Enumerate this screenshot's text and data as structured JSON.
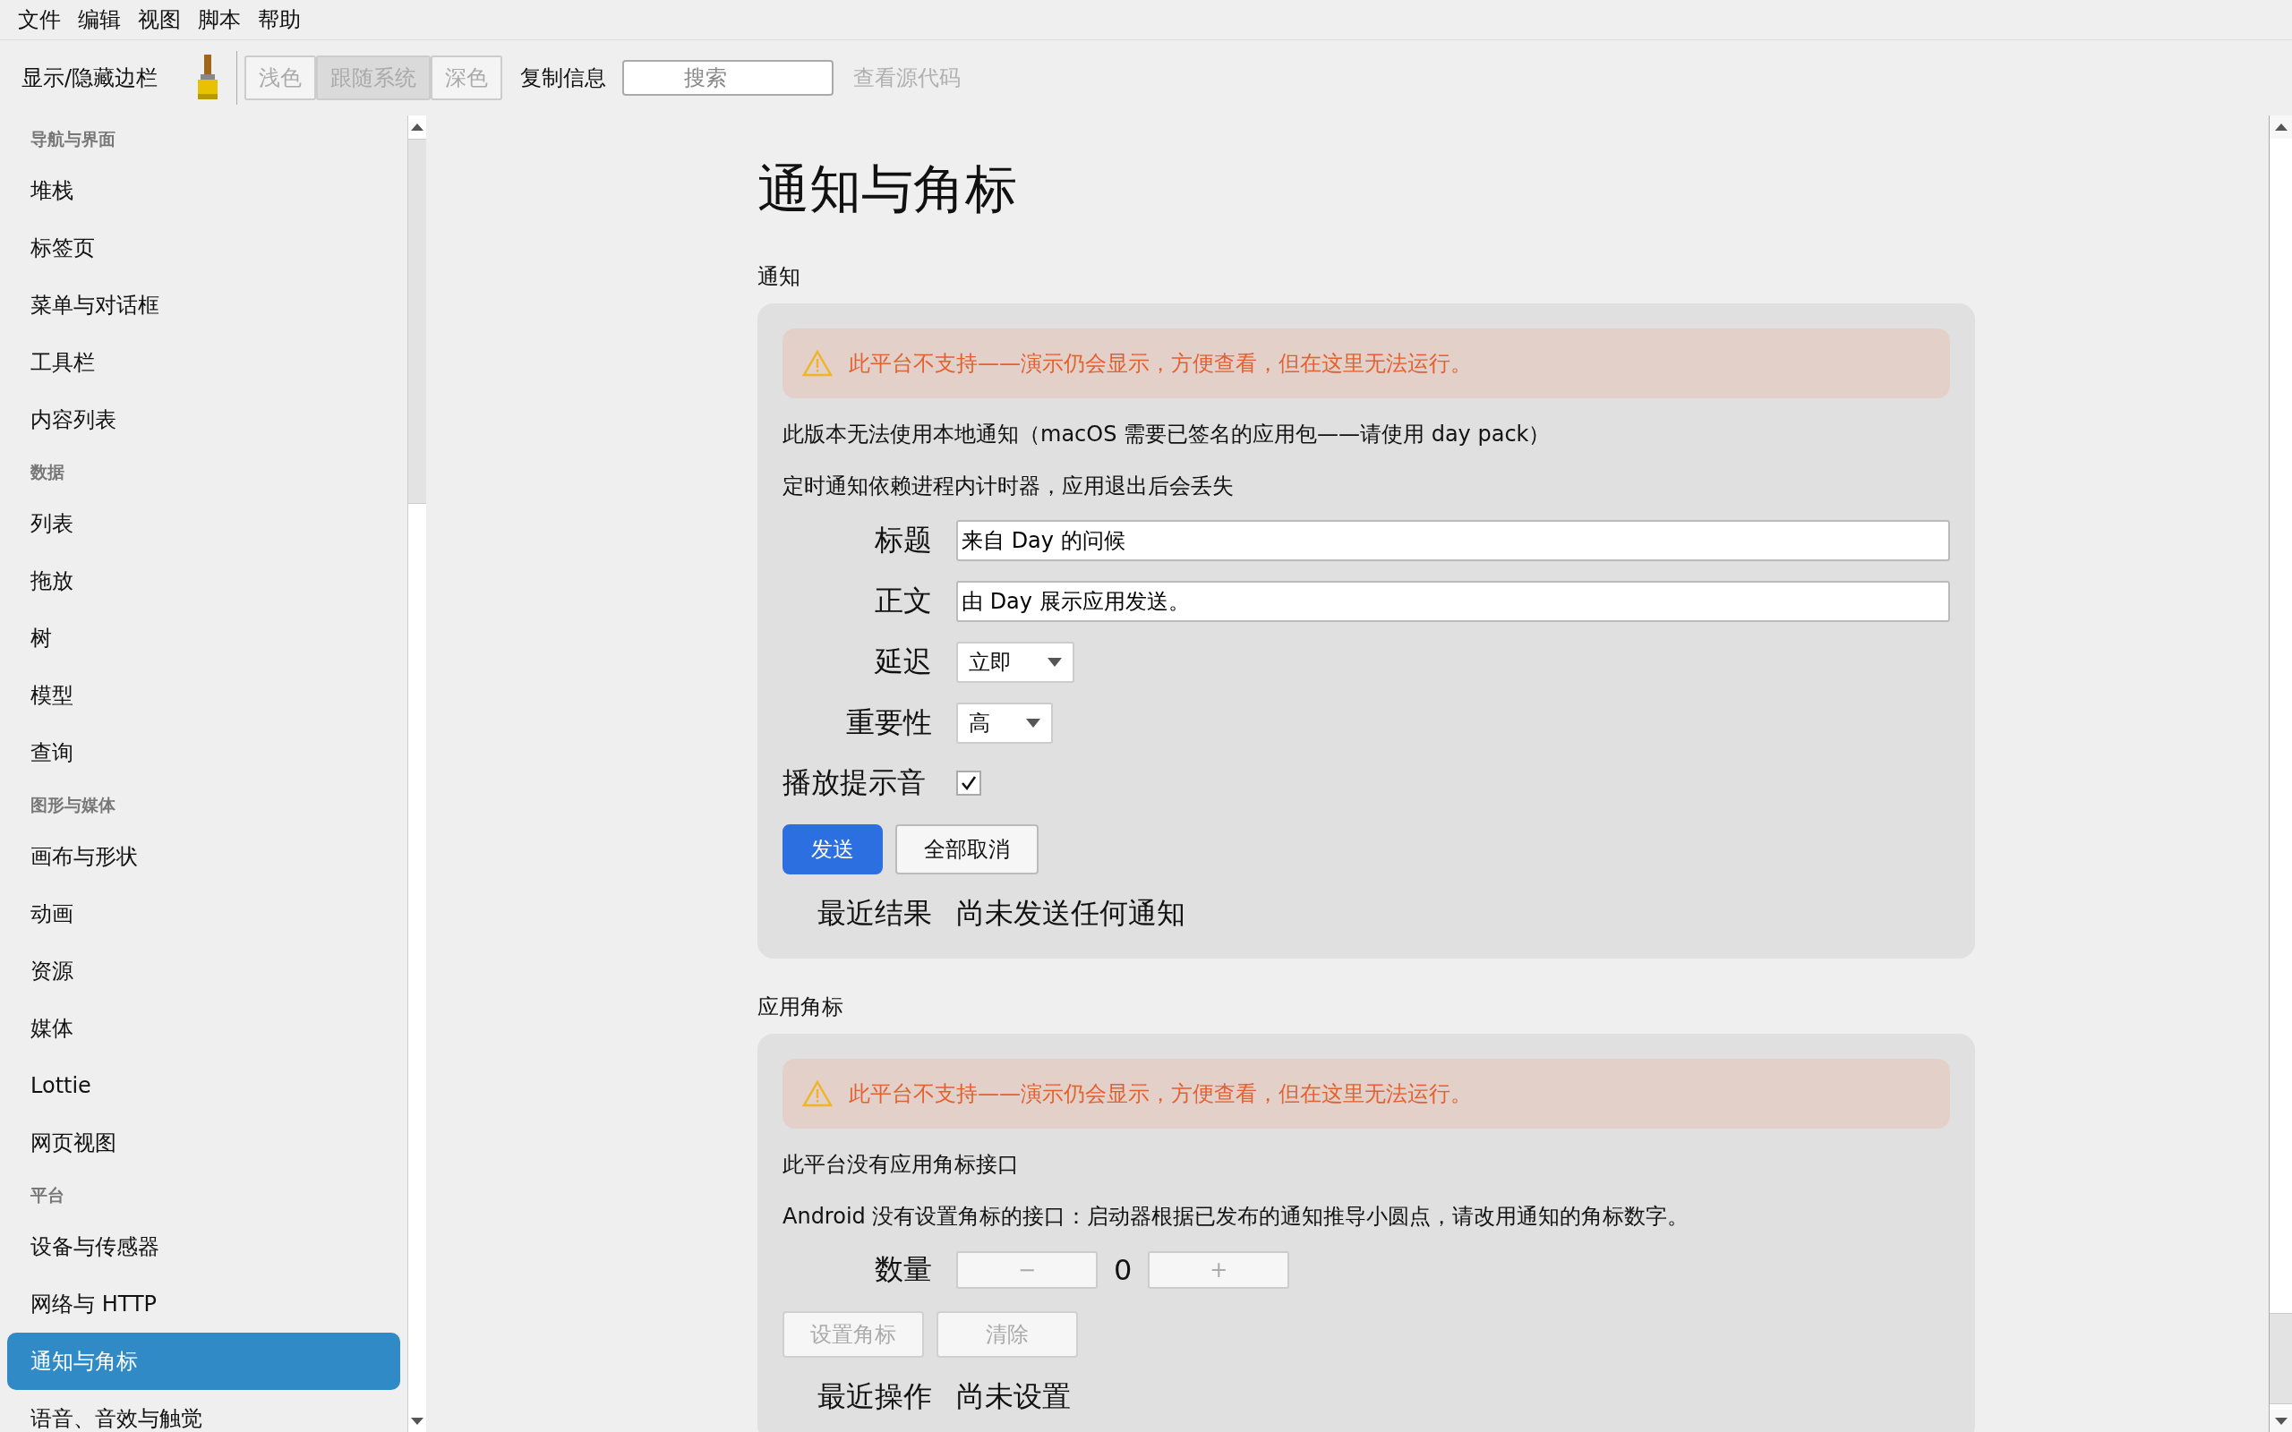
{
  "menu_bar": [
    "文件",
    "编辑",
    "视图",
    "脚本",
    "帮助"
  ],
  "toolbar": {
    "sidebar_toggle": "显示/隐藏边栏",
    "theme_buttons": [
      {
        "label": "浅色",
        "selected": false
      },
      {
        "label": "跟随系统",
        "selected": true
      },
      {
        "label": "深色",
        "selected": false
      }
    ],
    "copy_info": "复制信息",
    "search": {
      "placeholder": "搜索"
    },
    "view_source": {
      "label": "查看源代码",
      "disabled": true
    }
  },
  "sidebar": {
    "groups": [
      {
        "header": "导航与界面",
        "items": [
          {
            "label": "堆栈",
            "selected": false
          },
          {
            "label": "标签页",
            "selected": false
          },
          {
            "label": "菜单与对话框",
            "selected": false
          },
          {
            "label": "工具栏",
            "selected": false
          },
          {
            "label": "内容列表",
            "selected": false
          }
        ]
      },
      {
        "header": "数据",
        "items": [
          {
            "label": "列表",
            "selected": false
          },
          {
            "label": "拖放",
            "selected": false
          },
          {
            "label": "树",
            "selected": false
          },
          {
            "label": "模型",
            "selected": false
          },
          {
            "label": "查询",
            "selected": false
          }
        ]
      },
      {
        "header": "图形与媒体",
        "items": [
          {
            "label": "画布与形状",
            "selected": false
          },
          {
            "label": "动画",
            "selected": false
          },
          {
            "label": "资源",
            "selected": false
          },
          {
            "label": "媒体",
            "selected": false
          },
          {
            "label": "Lottie",
            "selected": false
          },
          {
            "label": "网页视图",
            "selected": false
          }
        ]
      },
      {
        "header": "平台",
        "items": [
          {
            "label": "设备与传感器",
            "selected": false
          },
          {
            "label": "网络与 HTTP",
            "selected": false
          },
          {
            "label": "通知与角标",
            "selected": true
          },
          {
            "label": "语音、音效与触觉",
            "selected": false
          }
        ]
      }
    ]
  },
  "page": {
    "title": "通知与角标",
    "sections": [
      {
        "heading": "通知",
        "warning": "此平台不支持——演示仍会显示，方便查看，但在这里无法运行。",
        "notes": [
          "此版本无法使用本地通知（macOS 需要已签名的应用包——请使用 day pack）",
          "定时通知依赖进程内计时器，应用退出后会丢失"
        ],
        "rows": [
          {
            "kind": "text",
            "label": "标题",
            "value": "来自 Day 的问候"
          },
          {
            "kind": "text",
            "label": "正文",
            "value": "由 Day 展示应用发送。"
          },
          {
            "kind": "select",
            "label": "延迟",
            "value": "立即"
          },
          {
            "kind": "select",
            "label": "重要性",
            "value": "高"
          },
          {
            "kind": "checkbox",
            "label": "播放提示音",
            "checked": true
          },
          {
            "kind": "buttons",
            "buttons": [
              {
                "label": "发送",
                "primary": true,
                "disabled": false
              },
              {
                "label": "全部取消",
                "primary": false,
                "disabled": false
              }
            ]
          },
          {
            "kind": "result",
            "label": "最近结果",
            "value": "尚未发送任何通知"
          }
        ]
      },
      {
        "heading": "应用角标",
        "warning": "此平台不支持——演示仍会显示，方便查看，但在这里无法运行。",
        "notes": [
          "此平台没有应用角标接口",
          "Android 没有设置角标的接口：启动器根据已发布的通知推导小圆点，请改用通知的角标数字。"
        ],
        "rows": [
          {
            "kind": "stepper",
            "label": "数量",
            "minus": "−",
            "value": "0",
            "plus": "+",
            "disabled": true
          },
          {
            "kind": "buttons",
            "buttons": [
              {
                "label": "设置角标",
                "primary": false,
                "disabled": true
              },
              {
                "label": "清除",
                "primary": false,
                "disabled": true
              }
            ]
          },
          {
            "kind": "result",
            "label": "最近操作",
            "value": "尚未设置"
          }
        ]
      }
    ]
  }
}
